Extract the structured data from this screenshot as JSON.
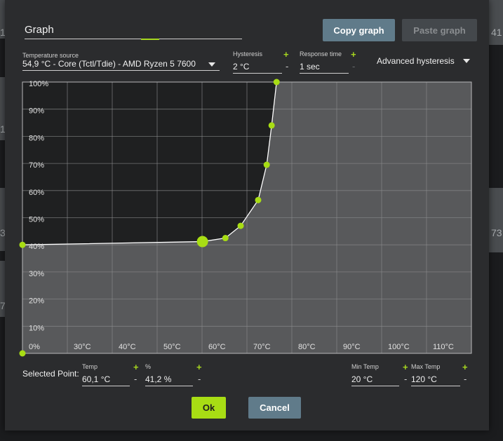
{
  "background": {
    "left_numbers": [
      "1",
      "1",
      "3",
      "7"
    ],
    "right_numbers": [
      "41",
      "73"
    ]
  },
  "dialog": {
    "title_value": "Graph",
    "copy_button": "Copy graph",
    "paste_button": "Paste graph",
    "temperature_source": {
      "label": "Temperature source",
      "value": "54,9 °C - Core (Tctl/Tdie) - AMD Ryzen 5 7600"
    },
    "hysteresis": {
      "label": "Hysteresis",
      "value": "2 °C",
      "plus": "+",
      "minus": "-"
    },
    "response_time": {
      "label": "Response time",
      "value": "1 sec",
      "plus": "+",
      "minus": "-"
    },
    "advanced_hysteresis": "Advanced hysteresis",
    "selected_point": {
      "label": "Selected Point:",
      "temp_label": "Temp",
      "temp_value": "60,1 °C",
      "percent_label": "%",
      "percent_value": "41,2 %",
      "plus": "+",
      "minus": "-"
    },
    "min_temp": {
      "label": "Min Temp",
      "value": "20 °C",
      "plus": "+",
      "minus": "-"
    },
    "max_temp": {
      "label": "Max Temp",
      "value": "120 °C",
      "plus": "+",
      "minus": "-"
    },
    "ok_button": "Ok",
    "cancel_button": "Cancel"
  },
  "colors": {
    "accent": "#a8dd14",
    "button_blue": "#607b8a",
    "dialog_bg": "#2b2c2e",
    "graph_bg": "#1f2021",
    "graph_fill": "#58595b"
  },
  "chart_data": {
    "type": "line",
    "xlim": [
      20,
      120
    ],
    "ylim": [
      0,
      100
    ],
    "x_tick_labels": [
      "0%",
      "30°C",
      "40°C",
      "50°C",
      "60°C",
      "70°C",
      "80°C",
      "90°C",
      "100°C",
      "110°C"
    ],
    "y_tick_labels": [
      "100%",
      "90%",
      "80%",
      "70%",
      "60%",
      "50%",
      "40%",
      "30%",
      "20%",
      "10%"
    ],
    "grid": true,
    "points": [
      {
        "x": 20,
        "y": 40
      },
      {
        "x": 60.1,
        "y": 41.2
      },
      {
        "x": 65.2,
        "y": 42.5
      },
      {
        "x": 68.6,
        "y": 47
      },
      {
        "x": 72.5,
        "y": 56.5
      },
      {
        "x": 74.4,
        "y": 69.5
      },
      {
        "x": 75.5,
        "y": 84
      },
      {
        "x": 76.6,
        "y": 100
      }
    ],
    "selected_index": 1,
    "baseline_point": {
      "x": 20,
      "y": 0
    }
  }
}
